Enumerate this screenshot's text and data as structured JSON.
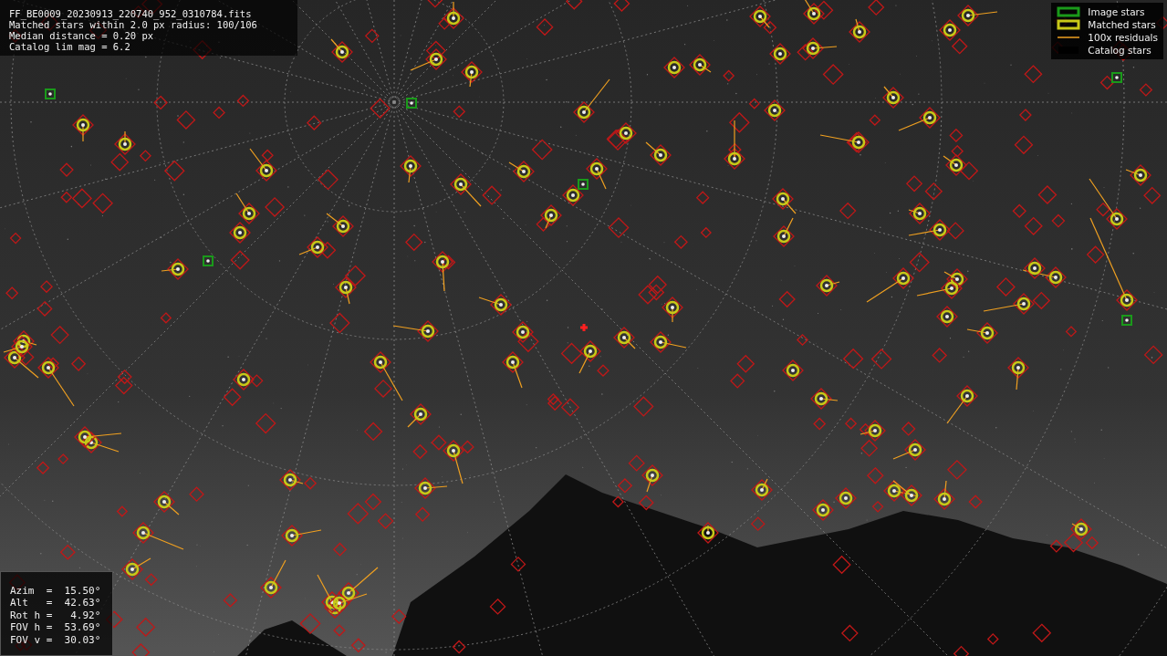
{
  "info": {
    "lines": [
      "FF_BE0009_20230913_220740_952_0310784.fits",
      "Matched stars within 2.0 px radius: 100/106",
      "Median distance = 0.20 px",
      "Catalog lim mag = 6.2"
    ]
  },
  "legend": {
    "items": [
      {
        "kind": "image",
        "label": "Image stars"
      },
      {
        "kind": "matched",
        "label": "Matched stars"
      },
      {
        "kind": "residual",
        "label": "100x residuals"
      },
      {
        "kind": "catalog",
        "label": "Catalog stars"
      }
    ]
  },
  "camera": {
    "rows": [
      "Azim  =  15.50°",
      "Alt   =  42.63°",
      "Rot h =   4.92°",
      "FOV h =  53.69°",
      "FOV v =  30.03°"
    ]
  }
}
